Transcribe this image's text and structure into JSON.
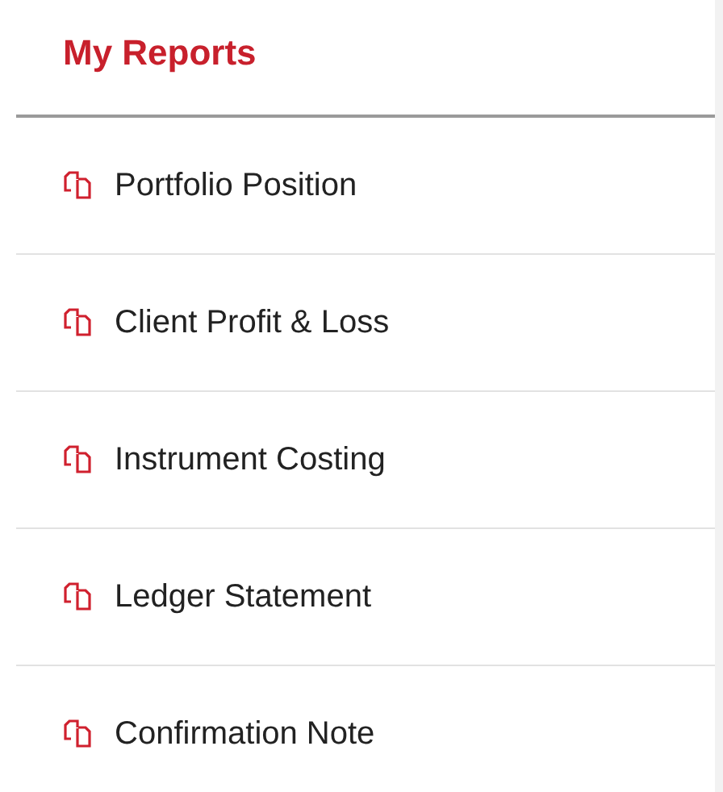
{
  "title": "My Reports",
  "reports": [
    {
      "label": "Portfolio Position"
    },
    {
      "label": "Client Profit & Loss"
    },
    {
      "label": "Instrument Costing"
    },
    {
      "label": "Ledger Statement"
    },
    {
      "label": "Confirmation Note"
    }
  ]
}
